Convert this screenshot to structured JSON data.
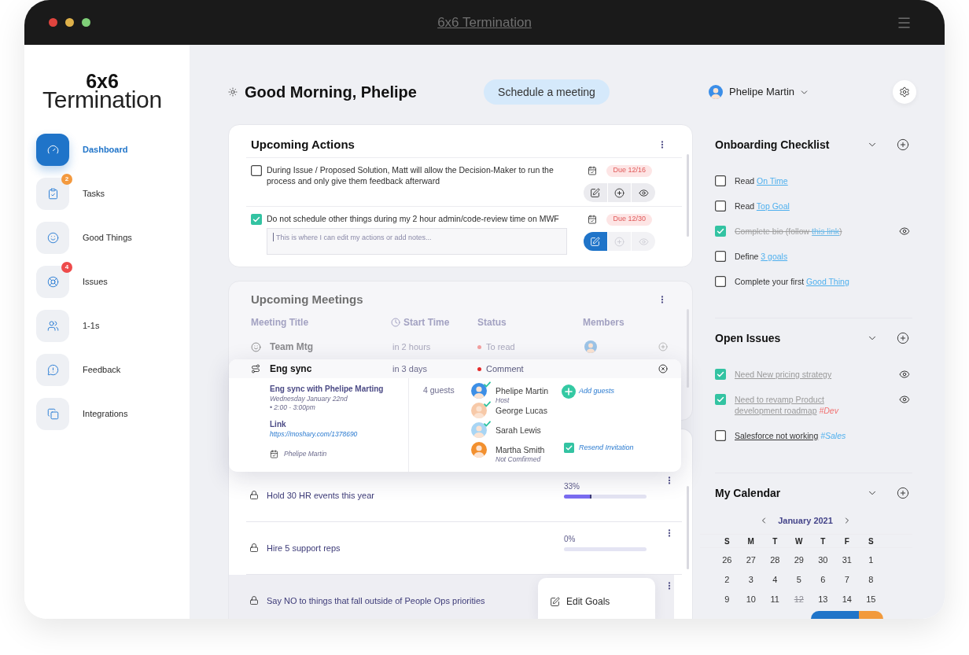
{
  "window": {
    "title": "6x6 Termination"
  },
  "logo": {
    "line_1": "6x6",
    "line_2": "Termination"
  },
  "sidebar": {
    "items": [
      {
        "label": "Dashboard",
        "selected": true
      },
      {
        "label": "Tasks",
        "selected": false,
        "badge": {
          "text": "2",
          "color": "#f3993e"
        }
      },
      {
        "label": "Good Things",
        "selected": false
      },
      {
        "label": "Issues",
        "selected": false,
        "badge": {
          "text": "4",
          "color": "#ee4b4b"
        }
      },
      {
        "label": "1-1s",
        "selected": false
      },
      {
        "label": "Feedback",
        "selected": false
      },
      {
        "label": "Integrations",
        "selected": false
      }
    ]
  },
  "header": {
    "greeting": "Good Morning, Phelipe",
    "schedule_button": "Schedule a meeting",
    "user_name": "Phelipe Martin"
  },
  "upcoming_actions": {
    "title": "Upcoming Actions",
    "items": [
      {
        "text": "During Issue / Proposed Solution, Matt will allow the Decision-Maker to run the process and only give them feedback afterward",
        "checked": false,
        "due": "Due 12/16",
        "buttons": [
          {
            "kind": "edit",
            "selected": false,
            "disabled": false
          },
          {
            "kind": "add",
            "selected": false,
            "disabled": false
          },
          {
            "kind": "view",
            "selected": false,
            "disabled": false
          }
        ]
      },
      {
        "text": "Do not schedule other things during my 2 hour admin/code-review time on MWF",
        "checked": true,
        "due": "Due 12/30",
        "notes": {
          "placeholder": "This is where I can edit my actions or add notes..."
        },
        "buttons": [
          {
            "kind": "edit",
            "selected": true,
            "disabled": false
          },
          {
            "kind": "add",
            "selected": false,
            "disabled": true
          },
          {
            "kind": "view",
            "selected": false,
            "disabled": true
          }
        ]
      }
    ]
  },
  "upcoming_meetings": {
    "title": "Upcoming Meetings",
    "columns": [
      "Meeting Title",
      "Start Time",
      "Status",
      "Members"
    ],
    "rows": [
      {
        "title": "Team Mtg",
        "start": "in 2 hours",
        "status": "To read",
        "expanded": false
      },
      {
        "title": "Eng sync",
        "start": "in 3 days",
        "status": "Comment",
        "expanded": true,
        "details": {
          "title": "Eng sync with Phelipe Marting",
          "date": "Wednesday January 22nd",
          "time": "• 2:00 - 3:00pm",
          "link_label": "Link",
          "link": "https://moshary.com/1378690",
          "organizer": "Phelipe Martin",
          "guest_count": "4 guests",
          "guests": [
            {
              "name": "Phelipe Martin",
              "note": "Host",
              "confirmed": true,
              "color": "#3d8fe6"
            },
            {
              "name": "George Lucas",
              "confirmed": true,
              "color": "#f7c9a8"
            },
            {
              "name": "Sarah Lewis",
              "confirmed": true,
              "color": "#a8d5f4"
            },
            {
              "name": "Martha Smith",
              "note": "Not Comfirmed",
              "confirmed": false,
              "color": "#f2902f"
            }
          ],
          "add_guests": "Add guests",
          "resend": {
            "label": "Resend Invitation",
            "checked": true
          }
        }
      }
    ]
  },
  "goals": {
    "items": [
      {
        "text": "Hold 30 HR events this year",
        "progress": "33%",
        "level": 0.33,
        "menu_open": false
      },
      {
        "text": "Hire 5 support reps",
        "progress": "0%",
        "menu_open": false
      },
      {
        "text": "Say NO to things that fall outside of People Ops priorities",
        "menu_open": true,
        "menu": [
          "Edit Goals"
        ]
      }
    ]
  },
  "onboarding": {
    "title": "Onboarding Checklist",
    "items": [
      {
        "text": "Read",
        "link": "On Time",
        "checked": false
      },
      {
        "text": "Read",
        "link": "Top Goal",
        "checked": false
      },
      {
        "text": "Complete bio (follow",
        "link": "this link",
        "text_after": ")",
        "checked": true
      },
      {
        "text": "Define",
        "link": "3 goals",
        "checked": false
      },
      {
        "text": "Complete your first",
        "link": "Good Thing",
        "checked": false
      }
    ]
  },
  "open_issues": {
    "title": "Open Issues",
    "items": [
      {
        "text": "Need New pricing strategy",
        "checked": true
      },
      {
        "text": "Need to revamp Product development roadmap",
        "tag": {
          "text": "#Dev",
          "color": "#f07272"
        },
        "checked": true
      },
      {
        "text": "Salesforce not working",
        "tag": {
          "text": "#Sales",
          "color": "#4fb0ee"
        },
        "checked": false
      }
    ]
  },
  "calendar": {
    "title": "My Calendar",
    "month": "January 2021",
    "weekdays": [
      "S",
      "M",
      "T",
      "W",
      "T",
      "F",
      "S"
    ],
    "weeks": [
      [
        {
          "day": "26",
          "disabled": false
        },
        {
          "day": "27",
          "disabled": false
        },
        {
          "day": "28",
          "disabled": false
        },
        {
          "day": "29",
          "disabled": false
        },
        {
          "day": "30",
          "disabled": false
        },
        {
          "day": "31",
          "disabled": false
        },
        {
          "day": "1",
          "disabled": false
        }
      ],
      [
        {
          "day": "2",
          "disabled": false
        },
        {
          "day": "3",
          "disabled": false
        },
        {
          "day": "4",
          "disabled": false
        },
        {
          "day": "5",
          "disabled": false
        },
        {
          "day": "6",
          "disabled": false
        },
        {
          "day": "7",
          "disabled": false
        },
        {
          "day": "8",
          "disabled": false
        }
      ],
      [
        {
          "day": "9",
          "disabled": false
        },
        {
          "day": "10",
          "disabled": false
        },
        {
          "day": "11",
          "disabled": false
        },
        {
          "day": "12",
          "disabled": true
        },
        {
          "day": "13",
          "disabled": false
        },
        {
          "day": "14",
          "disabled": false
        },
        {
          "day": "15",
          "disabled": false
        }
      ]
    ],
    "range_highlights": [
      {
        "color": "#1f74c9"
      },
      {
        "color": "#1f74c9"
      },
      {
        "color": "#f29a3c"
      }
    ]
  }
}
